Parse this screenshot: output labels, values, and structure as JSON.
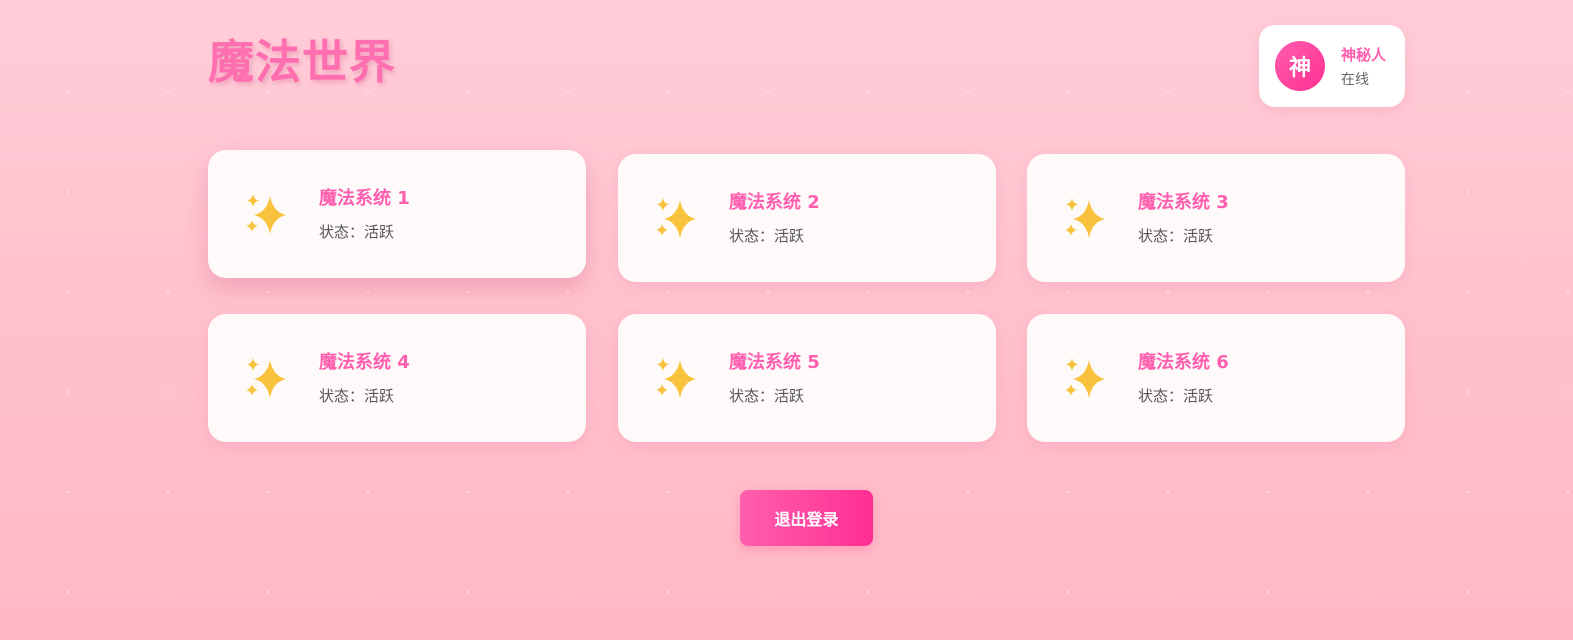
{
  "header": {
    "title": "魔法世界"
  },
  "user": {
    "avatar_char": "神",
    "name": "神秘人",
    "status": "在线"
  },
  "cards": [
    {
      "title": "魔法系统 1",
      "status": "状态：活跃",
      "icon": "sparkles-icon"
    },
    {
      "title": "魔法系统 2",
      "status": "状态：活跃",
      "icon": "sparkles-icon"
    },
    {
      "title": "魔法系统 3",
      "status": "状态：活跃",
      "icon": "sparkles-icon"
    },
    {
      "title": "魔法系统 4",
      "status": "状态：活跃",
      "icon": "sparkles-icon"
    },
    {
      "title": "魔法系统 5",
      "status": "状态：活跃",
      "icon": "sparkles-icon"
    },
    {
      "title": "魔法系统 6",
      "status": "状态：活跃",
      "icon": "sparkles-icon"
    }
  ],
  "logout_label": "退出登录",
  "colors": {
    "accent": "#ff5fae",
    "accent_dark": "#ff2f92",
    "sparkle": "#f9c23c",
    "background": "#ffc6d2"
  }
}
